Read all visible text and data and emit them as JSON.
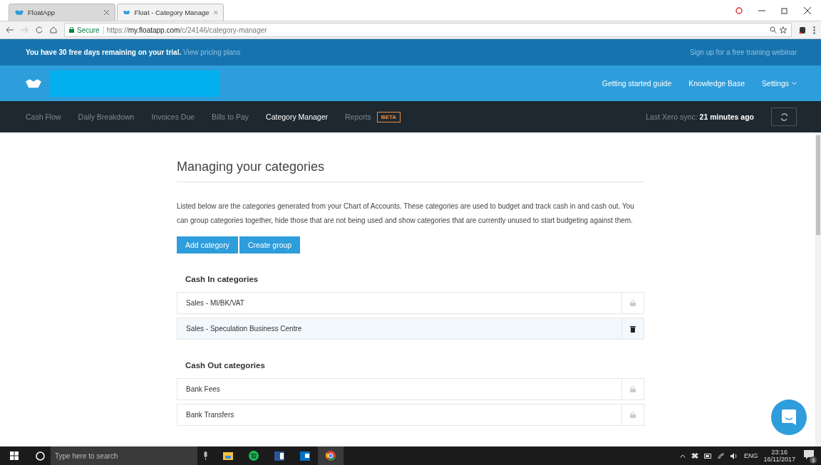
{
  "browser": {
    "tabs": [
      {
        "title": "FloatApp",
        "selected": false
      },
      {
        "title": "Float - Category Manage",
        "selected": true
      }
    ],
    "secure_label": "Secure",
    "url_scheme": "https://",
    "url_host": "my.floatapp.com",
    "url_path": "/c/24146/category-manager"
  },
  "trial_banner": {
    "message": "You have 30 free days remaining on your trial.",
    "link": "View pricing plans",
    "webinar": "Sign up for a free training webinar"
  },
  "header": {
    "links": [
      {
        "label": "Getting started guide",
        "kind": "link"
      },
      {
        "label": "Knowledge Base",
        "kind": "link"
      },
      {
        "label": "Settings",
        "kind": "menu"
      }
    ]
  },
  "nav": {
    "items": [
      {
        "label": "Cash Flow",
        "selected": false
      },
      {
        "label": "Daily Breakdown",
        "selected": false
      },
      {
        "label": "Invoices Due",
        "selected": false
      },
      {
        "label": "Bills to Pay",
        "selected": false
      },
      {
        "label": "Category Manager",
        "selected": true
      },
      {
        "label": "Reports",
        "selected": false,
        "badge": "BETA"
      }
    ],
    "sync_label": "Last Xero sync:",
    "sync_time": "21 minutes ago"
  },
  "page": {
    "title": "Managing your categories",
    "description": "Listed below are the categories generated from your Chart of Accounts. These categories are used to budget and track cash in and cash out. You can group categories together, hide those that are not being used and show categories that are currently unused to start budgeting against them.",
    "buttons": [
      "Add category",
      "Create group"
    ],
    "sections": [
      {
        "title": "Cash In categories",
        "rows": [
          {
            "name": "Sales - MI/BK/VAT",
            "kind": "locked",
            "highlighted": false
          },
          {
            "name": "Sales - Speculation Business Centre",
            "kind": "deletable",
            "highlighted": true
          }
        ]
      },
      {
        "title": "Cash Out categories",
        "rows": [
          {
            "name": "Bank Fees",
            "kind": "locked",
            "highlighted": false
          },
          {
            "name": "Bank Transfers",
            "kind": "locked",
            "highlighted": false
          }
        ]
      }
    ]
  },
  "taskbar": {
    "search_placeholder": "Type here to search",
    "language": "ENG",
    "time": "23:16",
    "date": "16/11/2017",
    "notifications": "3"
  }
}
